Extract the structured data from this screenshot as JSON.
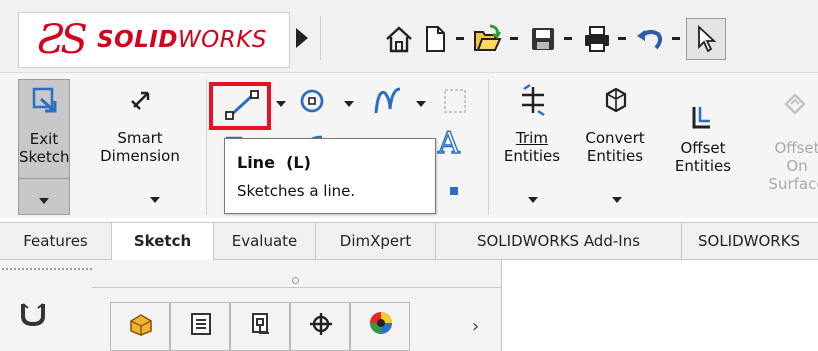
{
  "app": {
    "logo_ds": "ƧS",
    "logo_solid": "SOLID",
    "logo_works": "WORKS"
  },
  "quick_access": {
    "icons": [
      "home-icon",
      "new-document-icon",
      "open-folder-icon",
      "save-icon",
      "print-icon",
      "undo-icon",
      "select-pointer-icon"
    ]
  },
  "ribbon": {
    "exit_sketch": {
      "label_line1": "Exit",
      "label_line2": "Sketch"
    },
    "smart_dimension": {
      "label_line1": "Smart",
      "label_line2": "Dimension"
    },
    "trim_entities": {
      "label_line1": "Trim",
      "label_line2": "Entities"
    },
    "convert_entities": {
      "label_line1": "Convert",
      "label_line2": "Entities"
    },
    "offset_entities": {
      "label_line1": "Offset",
      "label_line2": "Entities"
    },
    "offset_on_surface": {
      "label_line1": "Offset",
      "label_line2": "On",
      "label_line3": "Surface"
    },
    "text_glyph": "A"
  },
  "tooltip": {
    "title": "Line  (L)",
    "description": "Sketches a line."
  },
  "tabs": [
    {
      "label": "Features",
      "active": false
    },
    {
      "label": "Sketch",
      "active": true
    },
    {
      "label": "Evaluate",
      "active": false
    },
    {
      "label": "DimXpert",
      "active": false
    },
    {
      "label": "SOLIDWORKS Add-Ins",
      "active": false
    },
    {
      "label": "SOLIDWORKS",
      "active": false
    }
  ],
  "feature_manager": {
    "tab_icons": [
      "part-icon",
      "property-manager-icon",
      "configuration-manager-icon",
      "dimxpert-manager-icon",
      "display-manager-icon"
    ],
    "more_arrow": "›"
  },
  "colors": {
    "brand_red": "#d7001a",
    "highlight": "#e81123",
    "sketch_blue": "#2b6fc4"
  }
}
